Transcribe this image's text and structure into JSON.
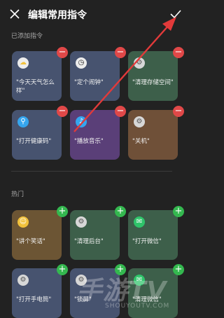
{
  "header": {
    "title": "编辑常用指令"
  },
  "section_added": {
    "title": "已添加指令"
  },
  "section_hot": {
    "title": "热门"
  },
  "added_cards": [
    {
      "label": "\"今天天气怎么样\"",
      "icon": "weather-icon",
      "color": "#47536f"
    },
    {
      "label": "\"定个闹钟\"",
      "icon": "alarm-clock-icon",
      "color": "#47536f"
    },
    {
      "label": "\"清理存储空间\"",
      "icon": "gear-icon",
      "color": "#3d5f4a"
    },
    {
      "label": "\"打开健康码\"",
      "icon": "health-code-icon",
      "color": "#47536f"
    },
    {
      "label": "\"播放音乐\"",
      "icon": "music-icon",
      "color": "#5a3f78"
    },
    {
      "label": "\"关机\"",
      "icon": "power-icon",
      "color": "#6f5038"
    }
  ],
  "hot_cards": [
    {
      "label": "\"讲个笑话\"",
      "icon": "smile-icon",
      "color": "#6c5534"
    },
    {
      "label": "\"清理后台\"",
      "icon": "gear-icon",
      "color": "#3d5f4a"
    },
    {
      "label": "\"打开微信\"",
      "icon": "wechat-icon",
      "color": "#3d5f4a"
    },
    {
      "label": "\"打开手电筒\"",
      "icon": "gear-icon",
      "color": "#47536f"
    },
    {
      "label": "\"锁屏\"",
      "icon": "gear-icon",
      "color": "#47536f"
    },
    {
      "label": "\"清理微信\"",
      "icon": "wechat-icon",
      "color": "#3d5f4a"
    }
  ],
  "badges": {
    "remove": "−",
    "add": "+"
  },
  "watermark": {
    "main": "手游TV",
    "sub": "SHOUYOUTV.COM"
  },
  "colors": {
    "remove_badge": "#e04848",
    "add_badge": "#34b84f",
    "arrow": "#e23a3a",
    "background": "#222222"
  }
}
